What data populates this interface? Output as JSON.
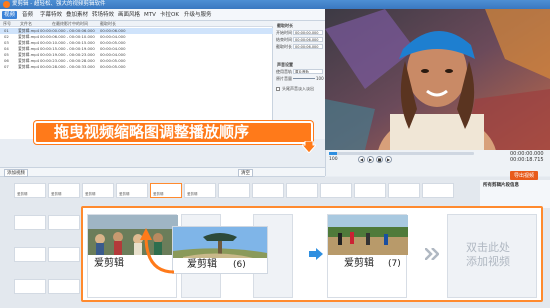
{
  "app": {
    "title": "爱剪辑 - 超轻松、强大的视频剪辑软件"
  },
  "menu": [
    "视频",
    "音频",
    "字幕特效",
    "叠加素材",
    "转场特效",
    "画面风格",
    "MTV",
    "卡拉OK",
    "升级与服务"
  ],
  "table": {
    "headers": [
      "序号",
      "文件名",
      "在最终影片中的时间",
      "截取时长"
    ],
    "rows": [
      [
        "01",
        "爱剪辑.mp4",
        "00:00:00.000 - 00:00:06.000",
        "00:00:06.000"
      ],
      [
        "02",
        "爱剪辑.mp4",
        "00:00:06.000 - 00:00:10.000",
        "00:00:04.000"
      ],
      [
        "03",
        "爱剪辑.mp4",
        "00:00:10.000 - 00:00:15.000",
        "00:00:05.000"
      ],
      [
        "04",
        "爱剪辑.mp4",
        "00:00:15.000 - 00:00:19.000",
        "00:00:04.000"
      ],
      [
        "05",
        "爱剪辑.mp4",
        "00:00:19.000 - 00:00:23.000",
        "00:00:04.000"
      ],
      [
        "06",
        "爱剪辑.mp4",
        "00:00:23.000 - 00:00:28.000",
        "00:00:05.000"
      ],
      [
        "07",
        "爱剪辑.mp4",
        "00:00:28.000 - 00:00:33.000",
        "00:00:05.000"
      ]
    ]
  },
  "params": {
    "section1": "截取时长",
    "start_label": "开始时间",
    "start_value": "00:00:00.000",
    "end_label": "结束时间",
    "end_value": "00:00:06.000",
    "dur_label": "截取时长",
    "dur_value": "00:00:06.000",
    "section2": "声音设置",
    "sound_label": "使用音轨",
    "sound_value": "原片音轨",
    "volume_label": "原片音量",
    "volume_value": "100",
    "headtail_label": "头尾声音淡入淡出",
    "confirm_btn": "确认修改"
  },
  "callout": {
    "text": "拖曳视频缩略图调整播放顺序"
  },
  "transport": {
    "timecode_total": "00:00:00.000",
    "timecode_current": "00:00:18.715",
    "zoom_value": "100"
  },
  "timeline": {
    "add_video": "添加视频",
    "clear_btn": "清空",
    "clip_label": "爱剪辑",
    "clip_left_label": "爱剪辑",
    "clip_drag_label": "爱剪辑",
    "clip_drag_num": "(6)",
    "clip_right_label": "爱剪辑",
    "clip_right_num": "(7)",
    "add_hint": "双击此处\n添加视频",
    "export_btn": "导出视频",
    "project_label": "所有剪辑片段信息"
  },
  "colors": {
    "accent": "#ff7a1a",
    "titlebar": "#3b82d8",
    "drop_arrow": "#2f8fe0"
  }
}
